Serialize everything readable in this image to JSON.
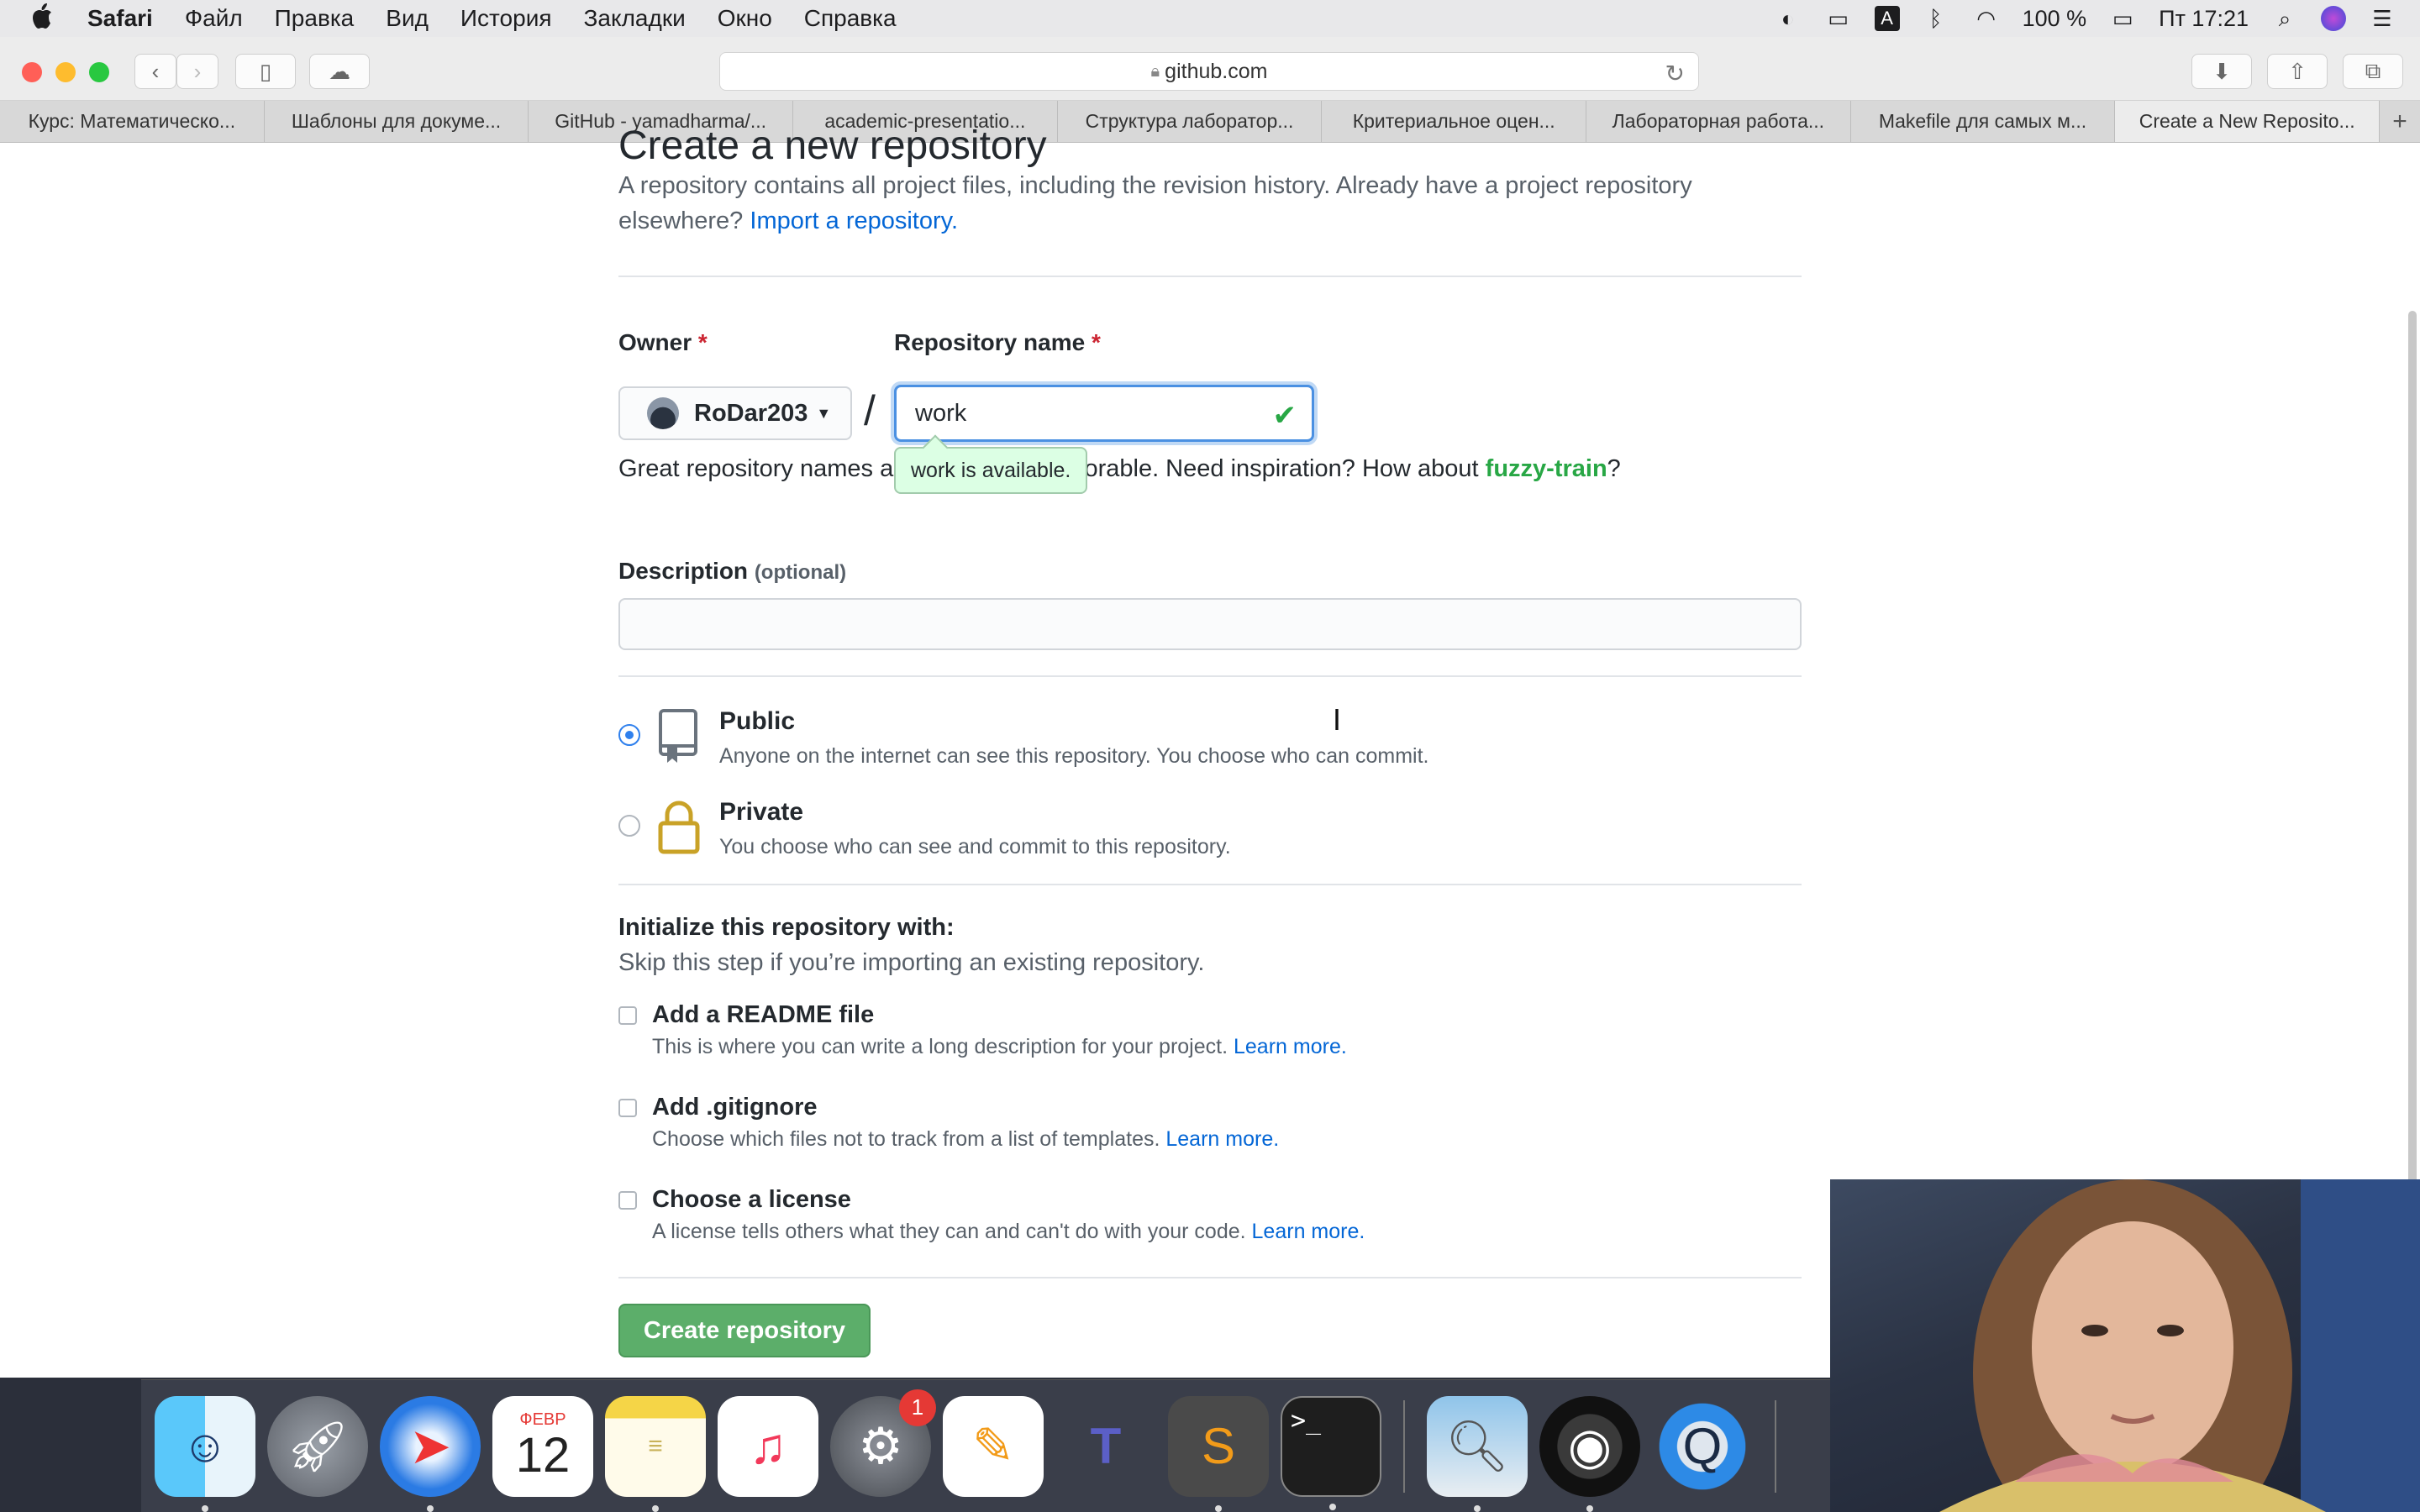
{
  "menubar": {
    "app_name": "Safari",
    "items": [
      "Файл",
      "Правка",
      "Вид",
      "История",
      "Закладки",
      "Окно",
      "Справка"
    ],
    "battery": "100 %",
    "clock": "Пт 17:21"
  },
  "toolbar": {
    "url": "github.com"
  },
  "tabs": [
    "Курс: Математическо...",
    "Шаблоны для докуме...",
    "GitHub - yamadharma/...",
    "academic-presentatio...",
    "Структура лаборатор...",
    "Критериальное оцен...",
    "Лабораторная работа...",
    "Makefile для самых м...",
    "Create a New Reposito..."
  ],
  "page": {
    "title": "Create a new repository",
    "lead_text": "A repository contains all project files, including the revision history. Already have a project repository elsewhere?",
    "import_link": "Import a repository.",
    "owner_label": "Owner",
    "required_mark": "*",
    "owner_value": "RoDar203",
    "slash": "/",
    "repo_label": "Repository name",
    "repo_value": "work",
    "hint_prefix": "Great repository names are short and memorable. Need inspiration? How about",
    "hint_suggestion": "fuzzy-train",
    "hint_suffix": "?",
    "tooltip": "work is available.",
    "description_label": "Description",
    "description_optional": "(optional)",
    "description_value": "",
    "visibility": [
      {
        "title": "Public",
        "desc": "Anyone on the internet can see this repository. You choose who can commit.",
        "selected": true
      },
      {
        "title": "Private",
        "desc": "You choose who can see and commit to this repository.",
        "selected": false
      }
    ],
    "init_title": "Initialize this repository with:",
    "init_sub": "Skip this step if you’re importing an existing repository.",
    "init_options": [
      {
        "title": "Add a README file",
        "desc": "This is where you can write a long description for your project.",
        "link": "Learn more."
      },
      {
        "title": "Add .gitignore",
        "desc": "Choose which files not to track from a list of templates.",
        "link": "Learn more."
      },
      {
        "title": "Choose a license",
        "desc": "A license tells others what they can and can't do with your code.",
        "link": "Learn more."
      }
    ],
    "create_button": "Create repository"
  },
  "dock": {
    "calendar_month": "ФЕВР",
    "calendar_day": "12",
    "settings_badge": "1"
  }
}
